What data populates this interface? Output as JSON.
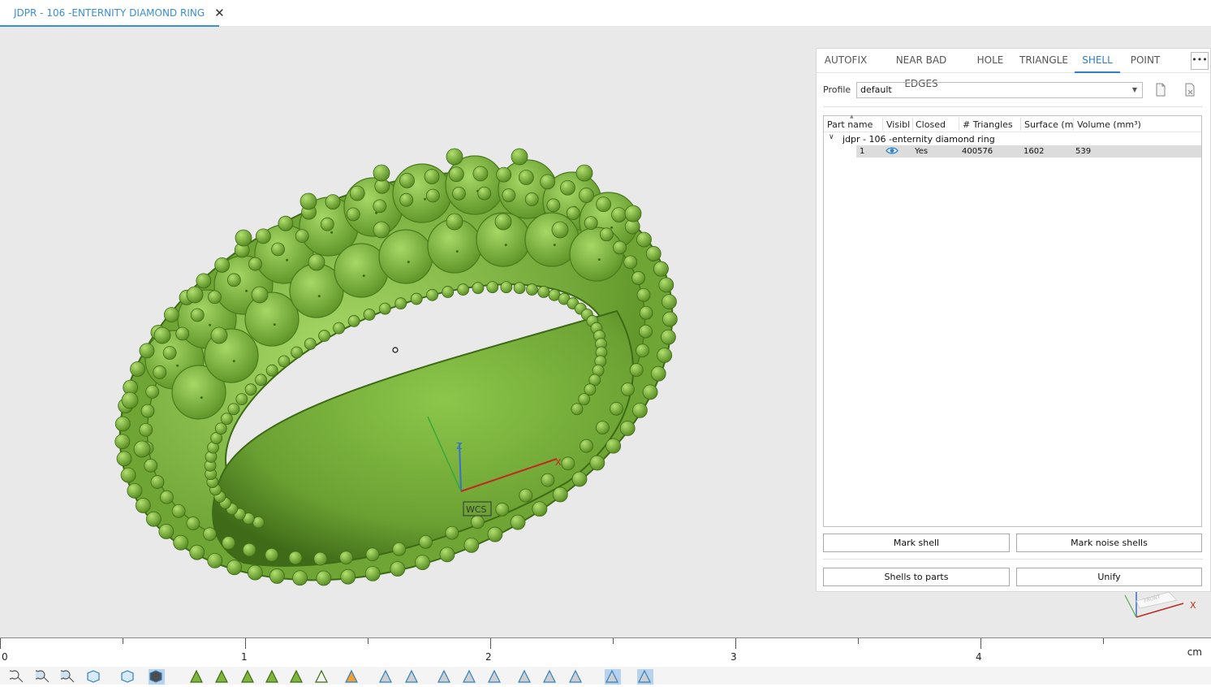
{
  "document_tab": {
    "title": "JDPR - 106 -ENTERNITY DIAMOND  RING",
    "close_glyph": "✕"
  },
  "viewport": {
    "background": "#e9e9e9",
    "model_color": "#7db53d",
    "wcs_label": "WCS",
    "axis_labels": {
      "z": "Z",
      "x": "X"
    }
  },
  "panel": {
    "tabs": [
      {
        "label": "AUTOFIX",
        "active": false
      },
      {
        "label": "NEAR BAD EDGES",
        "active": false
      },
      {
        "label": "HOLE",
        "active": false
      },
      {
        "label": "TRIANGLE",
        "active": false
      },
      {
        "label": "SHELL",
        "active": true
      },
      {
        "label": "POINT",
        "active": false
      }
    ],
    "more_label": "•••",
    "profile": {
      "label": "Profile",
      "value": "default"
    },
    "table": {
      "columns": [
        "Part name",
        "Visibl",
        "Closed",
        "# Triangles",
        "Surface (mr",
        "Volume (mm³)"
      ],
      "group": {
        "expander": "∨",
        "label": "jdpr - 106 -enternity diamond  ring"
      },
      "rows": [
        {
          "index": "1",
          "visible": "eye-icon",
          "closed": "Yes",
          "triangles": "400576",
          "surface": "1602",
          "volume": "539"
        }
      ]
    },
    "buttons": {
      "mark_shell": "Mark shell",
      "mark_noise_shells": "Mark noise shells",
      "shells_to_parts": "Shells to parts",
      "unify": "Unify"
    },
    "accent_color": "#2f80c5"
  },
  "triad": {
    "x_label": "X",
    "cube_label": "FRONT"
  },
  "ruler": {
    "labels": [
      "0",
      "1",
      "2",
      "3",
      "4"
    ],
    "unit": "cm"
  },
  "toolbar": {
    "icons": [
      "zoom-icon",
      "zoom-fit-icon",
      "zoom-selection-icon",
      "view-cube-icon",
      "view-box-icon",
      "shaded-view-icon",
      "triangle-view-icon",
      "surface-view-icon",
      "curve-view-icon",
      "section-view-icon",
      "sphere-view-icon",
      "wireframe-view-icon",
      "color-box-icon",
      "mesh-icon",
      "mesh-transform-icon",
      "mesh-delete-icon",
      "mesh-a-icon",
      "mesh-b-icon",
      "mesh-c-icon",
      "mesh-d-icon",
      "mesh-e-icon",
      "mesh-f-icon",
      "mesh-g-icon"
    ]
  }
}
